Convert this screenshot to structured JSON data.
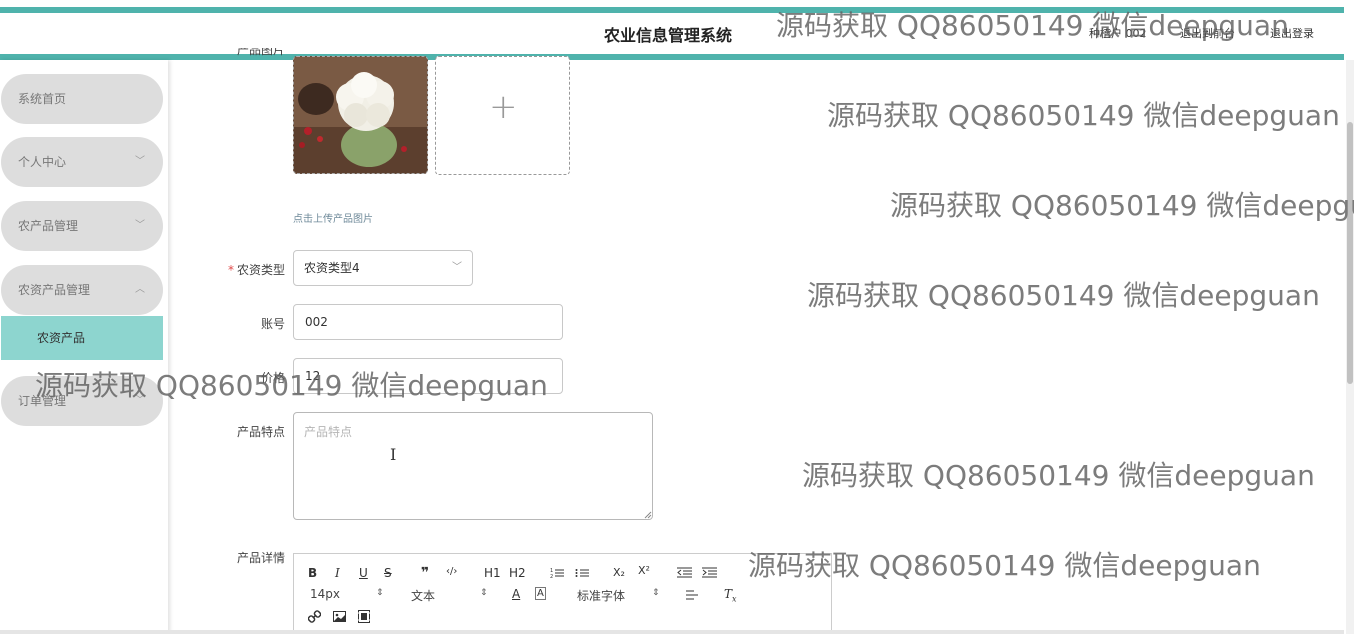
{
  "header": {
    "title": "农业信息管理系统",
    "user": "种植户 002",
    "back_link": "退出到前台",
    "logout_link": "退出登录",
    "accent_color": "#4fb3ac"
  },
  "sidebar": {
    "items": [
      {
        "label": "系统首页"
      },
      {
        "label": "个人中心"
      },
      {
        "label": "农产品管理"
      },
      {
        "label": "农资产品管理",
        "expanded": true,
        "children": [
          {
            "label": "农资产品",
            "active": true
          }
        ]
      },
      {
        "label": "订单管理"
      }
    ]
  },
  "form": {
    "image_label": "产品图片",
    "upload_hint": "点击上传产品图片",
    "type_label": "农资类型",
    "type_value": "农资类型4",
    "account_label": "账号",
    "account_value": "002",
    "price_label": "价格",
    "price_value": "12",
    "features_label": "产品特点",
    "features_placeholder": "产品特点",
    "details_label": "产品详情"
  },
  "editor": {
    "font_size": "14px",
    "format": "文本",
    "font_family": "标准字体",
    "tools": [
      "B",
      "I",
      "U",
      "S",
      "❞",
      "‹/›",
      "H1",
      "H2",
      "ordered-list",
      "bullet-list",
      "X₂",
      "X²",
      "outdent",
      "indent",
      "A",
      "highlight",
      "align",
      "clear-format",
      "link",
      "image",
      "video"
    ]
  },
  "watermark": {
    "text": "源码获取 QQ86050149 微信deepguan"
  }
}
